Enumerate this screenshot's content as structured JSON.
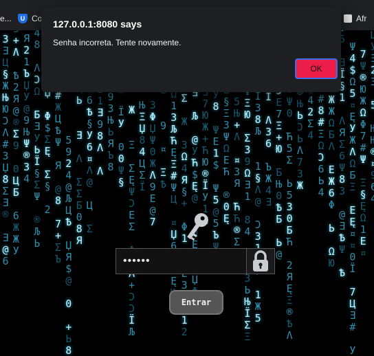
{
  "bookmarks": {
    "left_label": "e...",
    "mid_label": "Co",
    "right_label": "Afr"
  },
  "dialog": {
    "title": "127.0.0.1:8080 says",
    "message": "Senha incorreta. Tente novamente.",
    "ok_label": "OK"
  },
  "login": {
    "password_value": "••••••",
    "submit_label": "Entrar"
  },
  "colors": {
    "accent": "#ee1e4a",
    "rain_bright": "#bff4ff",
    "rain_dim": "#2c8fae"
  },
  "icons": [
    "key-icon",
    "lock-icon",
    "shield-icon"
  ]
}
